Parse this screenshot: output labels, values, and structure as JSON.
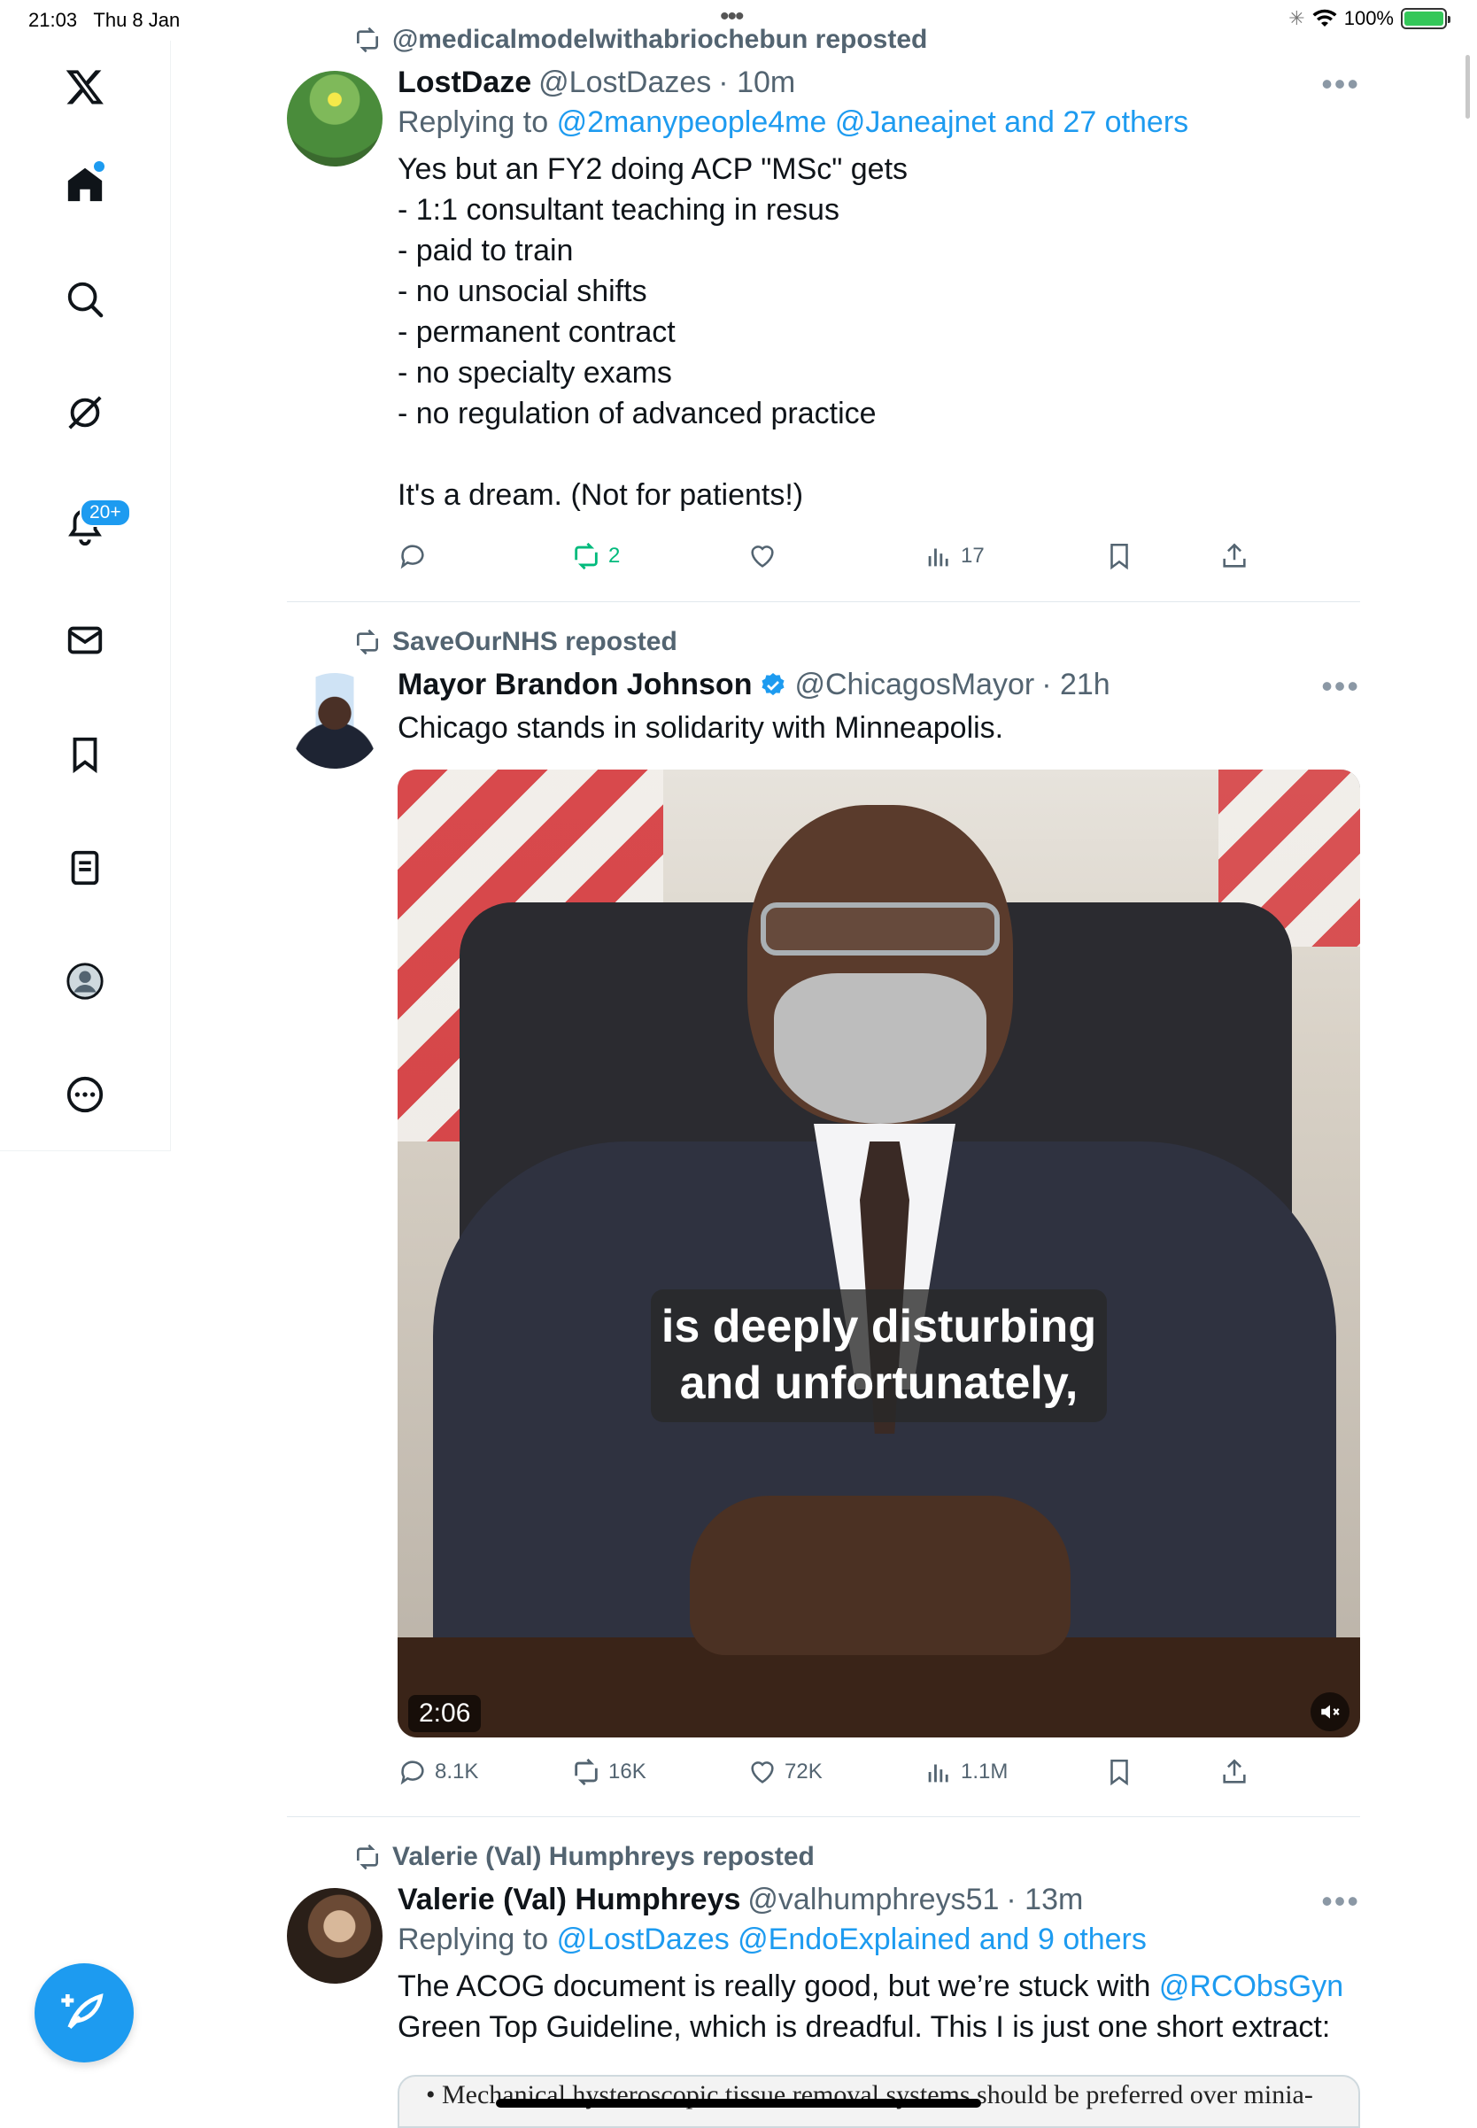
{
  "status_bar": {
    "time": "21:03",
    "date": "Thu 8 Jan",
    "battery": "100%"
  },
  "sidebar": {
    "notifications_badge": "20+",
    "items": [
      "x-logo",
      "home",
      "search",
      "grok",
      "notifications",
      "messages",
      "bookmarks",
      "lists",
      "profile",
      "more"
    ]
  },
  "colors": {
    "accent": "#1d9bf0",
    "retweet_active": "#00ba7c",
    "muted": "#536471"
  },
  "tweets": [
    {
      "repost_by": "@medicalmodelwithabriochebun reposted",
      "name": "LostDaze",
      "handle": "@LostDazes",
      "time": "· 10m",
      "replying_prefix": "Replying to",
      "replying_to": "@2manypeople4me @Janeajnet and 27 others",
      "text": "Yes but an FY2 doing ACP \"MSc\" gets\n- 1:1 consultant teaching in resus\n- paid to train\n- no unsocial shifts\n- permanent contract\n- no specialty exams\n- no regulation of advanced practice\n\nIt's a dream. (Not for patients!)",
      "replies": "",
      "reposts": "2",
      "likes": "",
      "views": "17"
    },
    {
      "repost_by": "SaveOurNHS reposted",
      "name": "Mayor Brandon Johnson",
      "verified": true,
      "handle": "@ChicagosMayor",
      "time": "· 21h",
      "text": "Chicago stands in solidarity with Minneapolis.",
      "video": {
        "caption": "is deeply disturbing\nand unfortunately,",
        "duration": "2:06"
      },
      "replies": "8.1K",
      "reposts": "16K",
      "likes": "72K",
      "views": "1.1M"
    },
    {
      "repost_by": "Valerie (Val) Humphreys reposted",
      "name": "Valerie (Val) Humphreys",
      "handle": "@valhumphreys51",
      "time": "· 13m",
      "replying_prefix": "Replying to",
      "replying_to": "@LostDazes @EndoExplained and 9 others",
      "text_before_link": "The ACOG document is really good, but we’re stuck with ",
      "text_link": "@RCObsGyn",
      "text_after_link": "\nGreen Top Guideline, which is dreadful. This I is just one short extract:",
      "image_text": "• Mechanical hysteroscopic tissue removal systems should be preferred over minia-"
    }
  ]
}
